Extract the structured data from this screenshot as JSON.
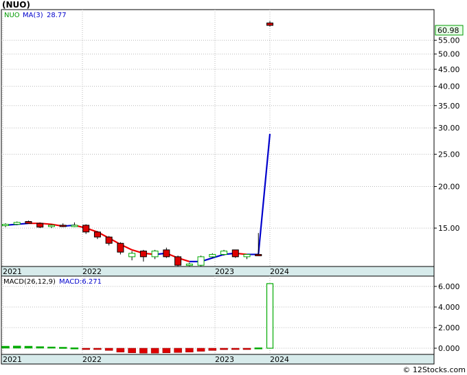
{
  "ticker_title": "(NUO)",
  "legend": {
    "symbol": "NUO",
    "ma_label": "MA(3)",
    "ma_value": "28.77"
  },
  "price_tag": "60.98",
  "macd_legend": {
    "params": "MACD(26,12,9)",
    "value_label": "MACD:6.271"
  },
  "watermark": "© 12Stocks.com",
  "colors": {
    "up": "#00aa00",
    "down": "#dd0000",
    "ma_down": "#ee0000",
    "ma_up": "#0000cc",
    "macd_pos": "#00aa00",
    "macd_neg": "#dd0000",
    "axis_band": "#d7ebeb",
    "grid": "#b8b8b8"
  },
  "chart_data": [
    {
      "type": "candlestick",
      "scale": "log",
      "y_ticks": [
        "55.00",
        "50.00",
        "45.00",
        "40.00",
        "35.00",
        "30.00",
        "25.00",
        "20.00",
        "15.00"
      ],
      "x_ticks": [
        "2021",
        "2022",
        "2023",
        "2024"
      ],
      "ylim": [
        11.5,
        68
      ],
      "last_price": 60.98,
      "candles": [
        {
          "o": 15.3,
          "h": 15.5,
          "l": 15.1,
          "c": 15.4
        },
        {
          "o": 15.4,
          "h": 15.7,
          "l": 15.3,
          "c": 15.6
        },
        {
          "o": 15.7,
          "h": 15.8,
          "l": 15.5,
          "c": 15.5
        },
        {
          "o": 15.5,
          "h": 15.6,
          "l": 15.0,
          "c": 15.1
        },
        {
          "o": 15.2,
          "h": 15.4,
          "l": 15.0,
          "c": 15.3
        },
        {
          "o": 15.3,
          "h": 15.5,
          "l": 15.1,
          "c": 15.2
        },
        {
          "o": 15.2,
          "h": 15.6,
          "l": 15.1,
          "c": 15.3
        },
        {
          "o": 15.3,
          "h": 15.4,
          "l": 14.4,
          "c": 14.6
        },
        {
          "o": 14.6,
          "h": 14.7,
          "l": 13.9,
          "c": 14.1
        },
        {
          "o": 14.1,
          "h": 14.2,
          "l": 13.3,
          "c": 13.5
        },
        {
          "o": 13.5,
          "h": 13.6,
          "l": 12.5,
          "c": 12.7
        },
        {
          "o": 12.3,
          "h": 12.8,
          "l": 12.0,
          "c": 12.6
        },
        {
          "o": 12.8,
          "h": 12.9,
          "l": 11.9,
          "c": 12.3
        },
        {
          "o": 12.3,
          "h": 12.9,
          "l": 12.1,
          "c": 12.8
        },
        {
          "o": 12.9,
          "h": 13.1,
          "l": 12.2,
          "c": 12.3
        },
        {
          "o": 12.3,
          "h": 12.4,
          "l": 11.5,
          "c": 11.6
        },
        {
          "o": 11.6,
          "h": 11.8,
          "l": 11.5,
          "c": 11.7
        },
        {
          "o": 11.6,
          "h": 12.4,
          "l": 11.5,
          "c": 12.3
        },
        {
          "o": 12.3,
          "h": 12.6,
          "l": 12.2,
          "c": 12.5
        },
        {
          "o": 12.5,
          "h": 12.9,
          "l": 12.4,
          "c": 12.8
        },
        {
          "o": 12.9,
          "h": 12.9,
          "l": 12.2,
          "c": 12.3
        },
        {
          "o": 12.3,
          "h": 12.5,
          "l": 12.1,
          "c": 12.5
        },
        {
          "o": 12.5,
          "h": 14.5,
          "l": 12.4,
          "c": 12.4
        },
        {
          "o": 62.0,
          "h": 62.8,
          "l": 60.5,
          "c": 60.98
        }
      ],
      "ma": [
        15.3,
        15.4,
        15.5,
        15.5,
        15.4,
        15.2,
        15.3,
        15.0,
        14.6,
        14.0,
        13.4,
        12.9,
        12.6,
        12.5,
        12.6,
        12.2,
        11.9,
        11.9,
        12.2,
        12.5,
        12.6,
        12.5,
        12.5,
        28.77
      ]
    },
    {
      "type": "bar",
      "title": "MACD(26,12,9)",
      "y_ticks": [
        "6.000",
        "4.000",
        "2.000",
        "0.000"
      ],
      "x_ticks": [
        "2021",
        "2022",
        "2023",
        "2024"
      ],
      "ylim": [
        -0.6,
        7.0
      ],
      "values": [
        0.2,
        0.22,
        0.2,
        0.16,
        0.13,
        0.1,
        0.05,
        -0.02,
        -0.1,
        -0.22,
        -0.38,
        -0.45,
        -0.48,
        -0.48,
        -0.45,
        -0.42,
        -0.38,
        -0.3,
        -0.22,
        -0.14,
        -0.06,
        -0.02,
        0.05,
        6.271
      ]
    }
  ]
}
